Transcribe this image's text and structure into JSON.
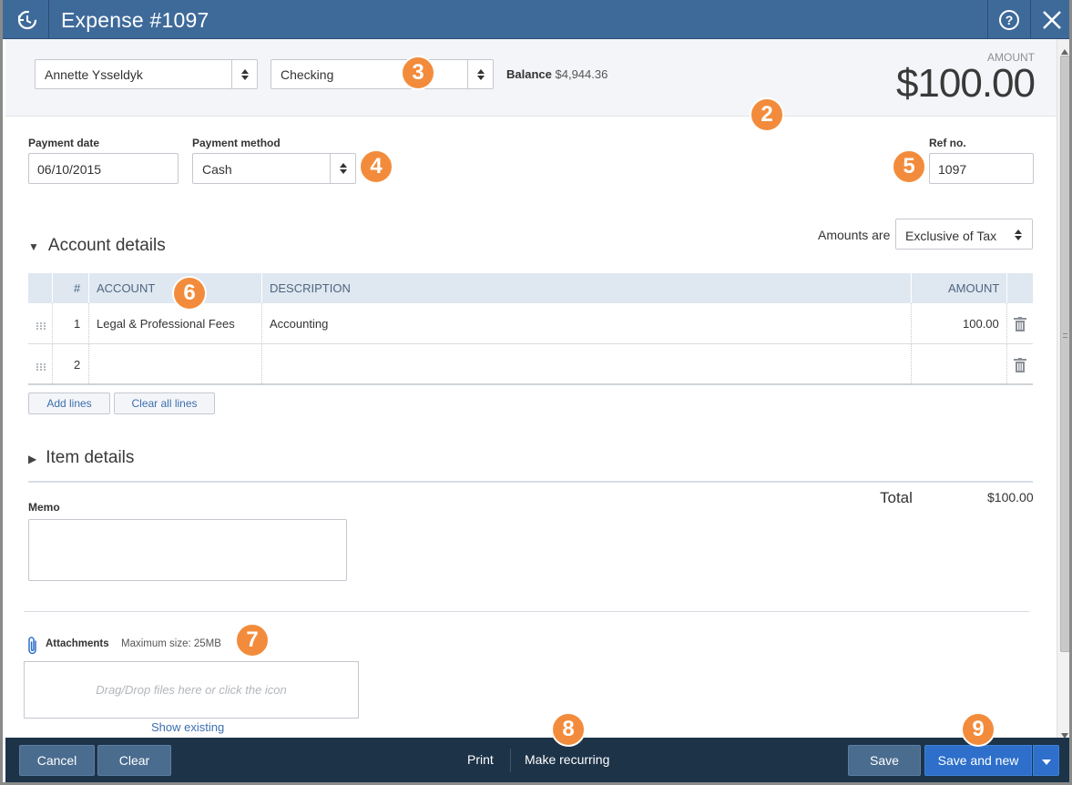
{
  "window": {
    "title": "Expense #1097"
  },
  "header": {
    "payee": "Annette Ysseldyk",
    "account": "Checking",
    "balance_label": "Balance",
    "balance_value": "$4,944.36",
    "amount_label": "AMOUNT",
    "amount_value": "$100.00"
  },
  "fields": {
    "payment_date_label": "Payment date",
    "payment_date_value": "06/10/2015",
    "payment_method_label": "Payment method",
    "payment_method_value": "Cash",
    "ref_no_label": "Ref no.",
    "ref_no_value": "1097",
    "amounts_are_label": "Amounts are",
    "amounts_are_value": "Exclusive of Tax"
  },
  "account_details": {
    "title": "Account details",
    "columns": [
      "#",
      "ACCOUNT",
      "DESCRIPTION",
      "AMOUNT"
    ],
    "rows": [
      {
        "num": "1",
        "account": "Legal & Professional Fees",
        "description": "Accounting",
        "amount": "100.00"
      },
      {
        "num": "2",
        "account": "",
        "description": "",
        "amount": ""
      }
    ],
    "add_lines": "Add lines",
    "clear_all_lines": "Clear all lines"
  },
  "item_details": {
    "title": "Item details"
  },
  "totals": {
    "total_label": "Total",
    "total_value": "$100.00"
  },
  "memo": {
    "label": "Memo",
    "value": ""
  },
  "attachments": {
    "label": "Attachments",
    "max_size": "Maximum size: 25MB",
    "drop_hint": "Drag/Drop files here or click the icon",
    "show_existing": "Show existing"
  },
  "footer": {
    "cancel": "Cancel",
    "clear": "Clear",
    "print": "Print",
    "make_recurring": "Make recurring",
    "save": "Save",
    "save_and_new": "Save and new"
  },
  "callouts": [
    "2",
    "3",
    "4",
    "5",
    "6",
    "7",
    "8",
    "9"
  ],
  "colors": {
    "titlebar": "#3e6a9a",
    "footer": "#1d3348",
    "primary_button": "#2d6fca",
    "callout": "#f28c3c",
    "table_header": "#dfe7f1"
  },
  "icons": {
    "app": "recent-transactions-icon",
    "help": "help-icon",
    "close": "close-icon",
    "delete": "trash-icon",
    "attach": "paperclip-icon",
    "drag": "drag-handle-icon"
  }
}
